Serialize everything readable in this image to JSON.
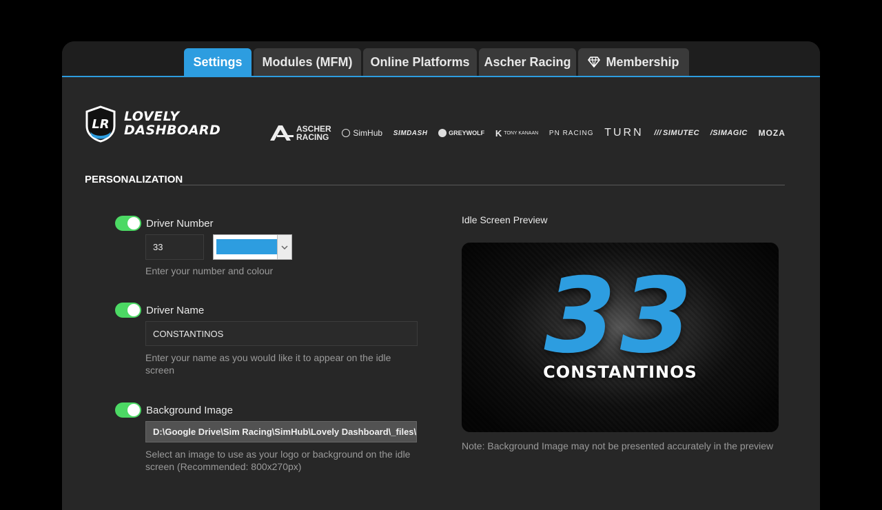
{
  "tabs": [
    {
      "label": "Settings",
      "active": true
    },
    {
      "label": "Modules (MFM)",
      "active": false
    },
    {
      "label": "Online Platforms",
      "active": false
    },
    {
      "label": "Ascher Racing",
      "active": false
    },
    {
      "label": "Membership",
      "active": false,
      "icon": "diamond-icon"
    }
  ],
  "logo": {
    "line1": "LOVELY",
    "line2": "DASHBOARD",
    "badge": "LR"
  },
  "sponsors": {
    "ascher_line1": "ASCHER",
    "ascher_line2": "RACING",
    "simhub": "SimHub",
    "simdash": "SIMDASH",
    "greywolf": "GREYWOLF",
    "tonykanaan": "TONY KANAAN",
    "pnracing": "PN RACING",
    "turn": "TURN",
    "simutec": "SIMUTEC",
    "simagic": "SIMAGIC",
    "moza": "MOZA"
  },
  "section": {
    "title": "PERSONALIZATION"
  },
  "driver_number": {
    "label": "Driver Number",
    "enabled": true,
    "value": "33",
    "color": "#2d9de0",
    "help": "Enter your number and colour"
  },
  "driver_name": {
    "label": "Driver Name",
    "enabled": true,
    "value": "CONSTANTINOS",
    "help": "Enter your name as you would like it to appear on the idle screen"
  },
  "background_image": {
    "label": "Background Image",
    "enabled": true,
    "value": "D:\\Google Drive\\Sim Racing\\SimHub\\Lovely Dashboard\\_files\\l",
    "help": "Select an image to use as your logo or background on the idle screen (Recommended: 800x270px)"
  },
  "preview": {
    "label": "Idle Screen Preview",
    "number": "33",
    "name": "CONSTANTINOS",
    "note": "Note: Background Image may not be presented accurately in the preview"
  },
  "colors": {
    "accent": "#2d9de0",
    "toggle_on": "#4cd964",
    "window_bg": "#272727"
  }
}
